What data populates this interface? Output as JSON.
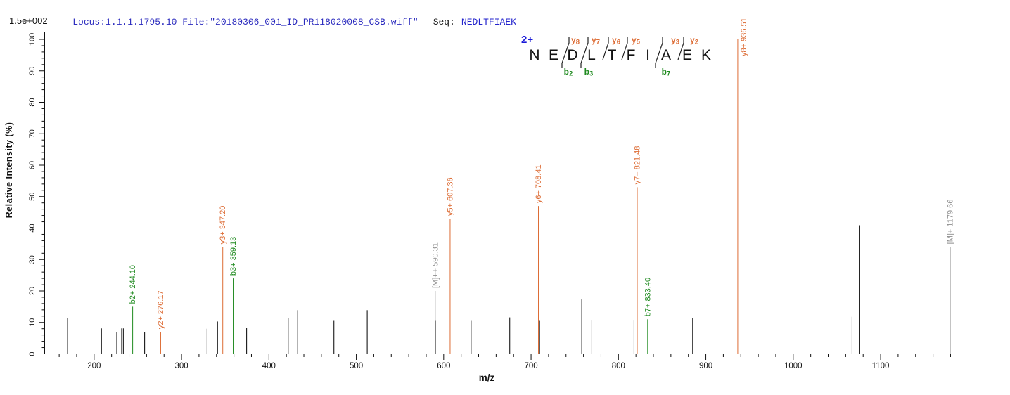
{
  "header": {
    "locus_file": "Locus:1.1.1.1795.10 File:\"20180306_001_ID_PR118020008_CSB.wiff\"",
    "seq_label": "Seq:",
    "seq_value": "NEDLTFIAEK",
    "scale_label": "1.5e+002"
  },
  "annotation": {
    "charge_label": "2+",
    "residues": [
      "N",
      "E",
      "D",
      "L",
      "T",
      "F",
      "I",
      "A",
      "E",
      "K"
    ],
    "y_ion_labels": [
      "y8",
      "y7",
      "y6",
      "y5",
      "y3",
      "y2"
    ],
    "b_ion_labels": [
      "b2",
      "b3",
      "b7"
    ]
  },
  "colors": {
    "y_ion": "#dd6c35",
    "b_ion": "#1f8a1f",
    "precursor": "#8e8e8e",
    "peak": "#000000",
    "axis": "#111111",
    "header_blue": "#2b2bbe",
    "charge_blue": "#1a1ad8"
  },
  "chart_data": {
    "type": "bar",
    "title": "MS/MS fragmentation spectrum of peptide NEDLTFIAEK (2+)",
    "xlabel": "m/z",
    "ylabel": "Relative Intensity (%)",
    "y_scale_note": "1.5e+002",
    "xlim": [
      143,
      1207
    ],
    "ylim": [
      0,
      100
    ],
    "x_major_ticks": [
      200,
      300,
      400,
      500,
      600,
      700,
      800,
      900,
      1000,
      1100
    ],
    "x_minor_tick_step": 20,
    "x_minor_tick_range": [
      160,
      1180
    ],
    "y_major_ticks": [
      0,
      10,
      20,
      30,
      40,
      50,
      60,
      70,
      80,
      90,
      100
    ],
    "y_minor_tick_step": 2,
    "grid": false,
    "annotated_peaks": [
      {
        "label": "b2+ 244.10",
        "ion_type": "b_ion",
        "mz": 244.1,
        "intensity": 15
      },
      {
        "label": "y2+ 276.17",
        "ion_type": "y_ion",
        "mz": 276.17,
        "intensity": 7
      },
      {
        "label": "y3+ 347.20",
        "ion_type": "y_ion",
        "mz": 347.2,
        "intensity": 34
      },
      {
        "label": "b3+ 359.13",
        "ion_type": "b_ion",
        "mz": 359.13,
        "intensity": 24
      },
      {
        "label": "[M]++ 590.31",
        "ion_type": "precursor",
        "mz": 590.31,
        "intensity": 20
      },
      {
        "label": "y5+ 607.36",
        "ion_type": "y_ion",
        "mz": 607.36,
        "intensity": 43
      },
      {
        "label": "y6+ 708.41",
        "ion_type": "y_ion",
        "mz": 708.41,
        "intensity": 47
      },
      {
        "label": "y7+ 821.48",
        "ion_type": "y_ion",
        "mz": 821.48,
        "intensity": 53
      },
      {
        "label": "b7+ 833.40",
        "ion_type": "b_ion",
        "mz": 833.4,
        "intensity": 11
      },
      {
        "label": "y8+ 936.51",
        "ion_type": "y_ion",
        "mz": 936.51,
        "intensity": 100
      },
      {
        "label": "[M]+ 1179.66",
        "ion_type": "precursor",
        "mz": 1179.66,
        "intensity": 34
      }
    ],
    "unannotated_peaks": [
      [
        169.6,
        11.4
      ],
      [
        208.4,
        8.1
      ],
      [
        225.9,
        7.0
      ],
      [
        231.5,
        8.1
      ],
      [
        233.4,
        8.1
      ],
      [
        257.8,
        6.9
      ],
      [
        329.2,
        8.0
      ],
      [
        341.2,
        10.3
      ],
      [
        374.5,
        8.2
      ],
      [
        422.1,
        11.4
      ],
      [
        432.9,
        13.9
      ],
      [
        474.4,
        10.5
      ],
      [
        512.5,
        13.9
      ],
      [
        590.6,
        10.5
      ],
      [
        631.4,
        10.5
      ],
      [
        675.6,
        11.6
      ],
      [
        709.7,
        10.5
      ],
      [
        758.0,
        17.3
      ],
      [
        769.5,
        10.6
      ],
      [
        817.8,
        10.6
      ],
      [
        884.9,
        11.4
      ],
      [
        1067.3,
        11.8
      ],
      [
        1076.1,
        40.9
      ]
    ]
  }
}
